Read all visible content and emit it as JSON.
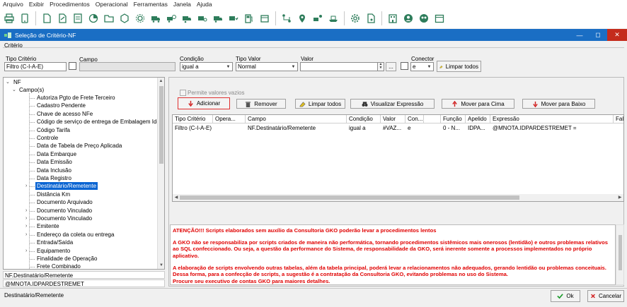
{
  "menu": [
    "Arquivo",
    "Exibir",
    "Procedimentos",
    "Operacional",
    "Ferramentas",
    "Janela",
    "Ajuda"
  ],
  "window": {
    "title": "Seleção de Critério-NF",
    "minimize": "—",
    "maximize": "◻",
    "close": "✕"
  },
  "criteria": {
    "section_label": "Critério",
    "tipo_criterio_label": "Tipo Critério",
    "tipo_criterio_value": "Filtro (C-I-A-E)",
    "campo_label": "Campo",
    "campo_value": "",
    "condicao_label": "Condição",
    "condicao_value": "igual a",
    "tipo_valor_label": "Tipo Valor",
    "tipo_valor_value": "Normal",
    "valor_label": "Valor",
    "valor_value": "",
    "conector_label": "Conector",
    "conector_value": "e",
    "ellipsis_label": "...",
    "limpar_todos_label": "Limpar todos"
  },
  "tree": {
    "root": "NF",
    "group": "Campo(s)",
    "items": [
      "Autoriza Pgto de Frete Terceiro",
      "Cadastro Pendente",
      "Chave de acesso NFe",
      "Código de serviço de entrega de Embalagem Identific",
      "Código Tarifa",
      "Controle",
      "Data de Tabela de Preço Aplicada",
      "Data Embarque",
      "Data Emissão",
      "Data Inclusão",
      "Data Registro",
      "Destinatário/Remetente",
      "Distância Km",
      "Documento Arquivado",
      "Documento Vinculado",
      "Documento Vinculado",
      "Emitente",
      "Endereço da coleta ou entrega",
      "Entrada/Saída",
      "Equipamento",
      "Finalidade de Operação",
      "Frete Combinado"
    ],
    "selected_index": 11,
    "footer_field": "NF.Destinatário/Remetente",
    "footer_expression": "@MNOTA.IDPARDESTREMET"
  },
  "actions": {
    "permite_label": "Permite valores vazios",
    "adicionar": "Adicionar",
    "remover": "Remover",
    "limpar_todos": "Limpar todos",
    "visualizar": "Visualizar Expressão",
    "mover_cima": "Mover para Cima",
    "mover_baixo": "Mover para Baixo"
  },
  "grid": {
    "headers": [
      "Tipo Critério",
      "Opera...",
      "Campo",
      "Condição",
      "Valor",
      "Con...",
      "",
      "Função",
      "Apelido",
      "Expressão",
      "Falt"
    ],
    "row": [
      "Filtro (C-I-A-E)",
      "",
      "NF.Destinatário/Remetente",
      "igual a",
      "#VAZ...",
      "e",
      "",
      "0 - N...",
      "IDPA...",
      "@MNOTA.IDPARDESTREMET =",
      ""
    ]
  },
  "warning": {
    "p1": "ATENÇÃO!!! Scripts elaborados sem auxílio da Consultoria GKO poderão levar a procedimentos lentos",
    "p2": "A GKO não se responsabiliza por scripts criados de maneira não performática, tornando procedimentos sistêmicos mais onerosos (lentidão) e outros problemas relativos ao SQL confeccionado. Ou seja, a questão da performance do Sistema, de responsabilidade da GKO, será inerente somente a processos implementados no próprio aplicativo.",
    "p3": "A elaboração de scripts envolvendo outras tabelas, além da tabela principal, poderá levar a relacionamentos não adequados, gerando lentidão ou problemas conceituais. Dessa forma, para a confecção de scripts, a sugestão é a contratação da Consultoria GKO, evitando problemas no uso do Sistema.\nProcure seu executivo de contas GKO para maiores detalhes."
  },
  "footer": {
    "status": "Destinatário/Remetente",
    "ok": "Ok",
    "cancel": "Cancelar"
  },
  "colors": {
    "accent": "#1a6ec4",
    "icon_green": "#2e7d5b",
    "warning": "#e00000",
    "selection": "#0a64d2",
    "highlight": "#e03030"
  }
}
